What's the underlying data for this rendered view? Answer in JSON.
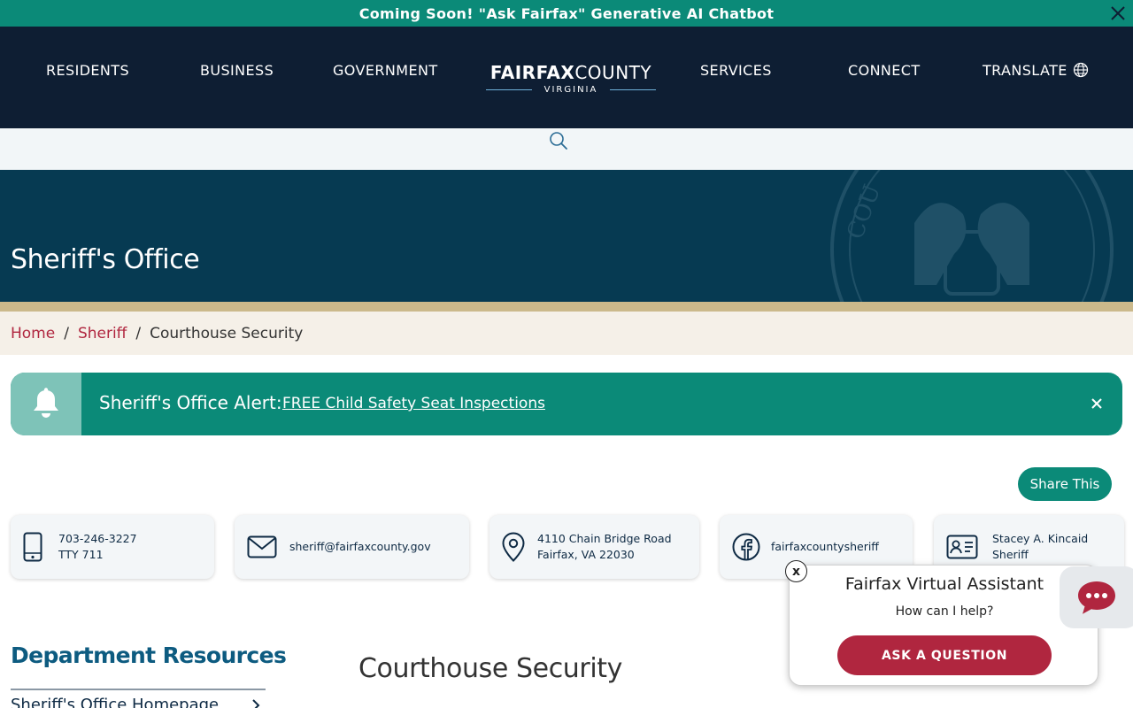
{
  "announcement": {
    "text": "Coming Soon! \"Ask Fairfax\" Generative AI Chatbot",
    "close_icon": "close-icon"
  },
  "nav": {
    "items": [
      "RESIDENTS",
      "BUSINESS",
      "GOVERNMENT",
      "SERVICES",
      "CONNECT",
      "TRANSLATE"
    ],
    "logo": {
      "bold": "FAIRFAX",
      "light": "COUNTY",
      "sub": "VIRGINIA"
    },
    "translate_icon": "globe-icon"
  },
  "search": {
    "icon": "search-icon"
  },
  "hero": {
    "title": "Sheriff's Office"
  },
  "breadcrumb": {
    "home": "Home",
    "sheriff": "Sheriff",
    "current": "Courthouse Security",
    "separator": "/"
  },
  "alert": {
    "label": "Sheriff's Office Alert:",
    "link": "FREE Child Safety Seat Inspections",
    "icon": "bell-icon"
  },
  "share": {
    "label": "Share This"
  },
  "contacts": {
    "phone": {
      "line1": "703-246-3227",
      "line2": "TTY 711",
      "icon": "phone-icon"
    },
    "email": {
      "line1": "sheriff@fairfaxcounty.gov",
      "icon": "mail-icon"
    },
    "address": {
      "line1": "4110 Chain Bridge Road",
      "line2": "Fairfax, VA 22030",
      "icon": "location-pin-icon"
    },
    "facebook": {
      "line1": "fairfaxcountysheriff",
      "icon": "facebook-icon"
    },
    "sheriff": {
      "line1": "Stacey A. Kincaid",
      "line2": "Sheriff",
      "icon": "id-card-icon"
    }
  },
  "sidebar": {
    "title": "Department Resources",
    "first_link": "Sheriff's Office Homepage"
  },
  "main": {
    "heading": "Courthouse Security"
  },
  "assistant": {
    "title": "Fairfax Virtual Assistant",
    "subtitle": "How can I help?",
    "button": "ASK A QUESTION",
    "close": "x",
    "launcher_icon": "chat-bubble-icon"
  },
  "colors": {
    "teal": "#0b8a78",
    "navy": "#0e1e33",
    "hero": "#063a52",
    "crimson": "#b0263f",
    "tan": "#cbb98b"
  }
}
